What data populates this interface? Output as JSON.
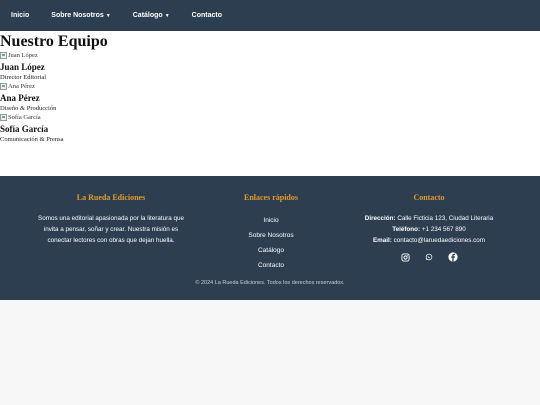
{
  "nav": {
    "items": [
      {
        "label": "Inicio",
        "caret": false
      },
      {
        "label": "Sobre Nosotros",
        "caret": true
      },
      {
        "label": "Catálogo",
        "caret": true
      },
      {
        "label": "Contacto",
        "caret": false
      }
    ]
  },
  "main": {
    "title": "Nuestro Equipo",
    "members": [
      {
        "alt": "Juan López",
        "name": "Juan López",
        "role": "Director Editorial"
      },
      {
        "alt": "Ana Pérez",
        "name": "Ana Pérez",
        "role": "Diseño & Producción"
      },
      {
        "alt": "Sofía García",
        "name": "Sofía García",
        "role": "Comunicación & Prensa"
      }
    ]
  },
  "footer": {
    "about": {
      "title": "La Rueda Ediciones",
      "text": "Somos una editorial apasionada por la literatura que invita a pensar, soñar y crear. Nuestra misión es conectar lectores con obras que dejan huella."
    },
    "links": {
      "title": "Enlaces rápidos",
      "items": [
        "Inicio",
        "Sobre Nosotros",
        "Catálogo",
        "Contacto"
      ]
    },
    "contact": {
      "title": "Contacto",
      "address_label": "Dirección:",
      "address": "Calle Ficticia 123, Ciudad Literaria",
      "phone_label": "Teléfono:",
      "phone": "+1 234 567 890",
      "email_label": "Email:",
      "email": "contacto@laruedaediciones.com"
    },
    "social_icons": [
      "instagram-icon",
      "whatsapp-icon",
      "facebook-icon"
    ],
    "copyright": "© 2024 La Rueda Ediciones. Todos los derechos reservados."
  },
  "colors": {
    "nav_bg": "#2c3e50",
    "accent": "#e39b2c"
  }
}
